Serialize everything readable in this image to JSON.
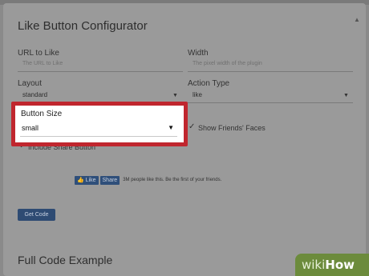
{
  "page": {
    "title": "Like Button Configurator",
    "footer_title": "Full Code Example"
  },
  "form": {
    "url": {
      "label": "URL to Like",
      "placeholder": "The URL to Like"
    },
    "width": {
      "label": "Width",
      "placeholder": "The pixel width of the plugin"
    },
    "layout": {
      "label": "Layout",
      "value": "standard"
    },
    "action_type": {
      "label": "Action Type",
      "value": "like"
    },
    "button_size": {
      "label": "Button Size",
      "value": "small"
    },
    "show_friends_faces": {
      "label": "Show Friends' Faces",
      "checked": true
    },
    "include_share": {
      "label": "Include Share Button",
      "checked": true
    }
  },
  "preview": {
    "like_label": "Like",
    "share_label": "Share",
    "social_text": "3M people like this. Be the first of your friends."
  },
  "get_code_label": "Get Code",
  "watermark": {
    "wiki": "wiki",
    "how": "How"
  },
  "colors": {
    "highlight": "#c0262e",
    "button_bg": "#2e4b73",
    "watermark_bg": "#6c8b3c"
  }
}
